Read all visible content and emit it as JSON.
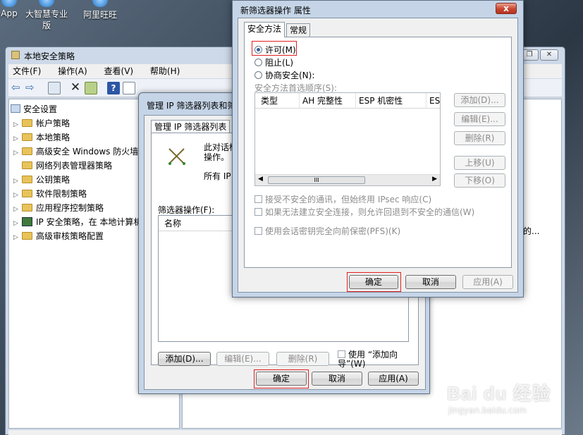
{
  "desktop": {
    "icons": [
      {
        "label": "App"
      },
      {
        "label": "大智慧专业版"
      },
      {
        "label": "阿里旺旺"
      }
    ]
  },
  "mmc": {
    "title": "本地安全策略",
    "menu": [
      "文件(F)",
      "操作(A)",
      "查看(V)",
      "帮助(H)"
    ],
    "tree": {
      "root": "安全设置",
      "items": [
        "帐户策略",
        "本地策略",
        "高级安全 Windows 防火墙",
        "网络列表管理器策略",
        "公钥策略",
        "软件限制策略",
        "应用程序控制策略",
        "IP 安全策略，在 本地计算机",
        "高级审核策略配置"
      ]
    },
    "right_pane_text": "的..."
  },
  "dialog_filter_list": {
    "title": "管理 IP 筛选器列表和筛",
    "tab_label": "管理 IP 筛选器列表",
    "desc_line1": "此对话框",
    "desc_line2": "操作。",
    "desc_line3": "所有 IP",
    "filter_actions_label": "筛选器操作(F):",
    "column_name": "名称",
    "add_button": "添加(D)...",
    "edit_button": "编辑(E)...",
    "delete_button": "删除(R)",
    "use_wizard_label": "使用 “添加向导”(W)",
    "ok_button": "确定",
    "cancel_button": "取消",
    "apply_button": "应用(A)"
  },
  "dialog_new_action": {
    "title": "新筛选器操作 属性",
    "close_label": "x",
    "tabs": [
      "安全方法",
      "常规"
    ],
    "radio_permit": "许可(M)",
    "radio_block": "阻止(L)",
    "radio_negotiate": "协商安全(N):",
    "method_order_label": "安全方法首选顺序(S):",
    "columns": [
      "类型",
      "AH 完整性",
      "ESP 机密性",
      "ESI"
    ],
    "scroll_grip": "III",
    "side_buttons": [
      "添加(D)...",
      "编辑(E)...",
      "删除(R)",
      "上移(U)",
      "下移(O)"
    ],
    "chk_unsecure": "接受不安全的通讯，但始终用 IPsec 响应(C)",
    "chk_fallback": "如果无法建立安全连接，则允许回退到不安全的通信(W)",
    "chk_pfs": "使用会话密钥完全向前保密(PFS)(K)",
    "ok_button": "确定",
    "cancel_button": "取消",
    "apply_button": "应用(A)"
  },
  "watermark": {
    "brand": "Bai du 经验",
    "url": "jingyan.baidu.com"
  }
}
